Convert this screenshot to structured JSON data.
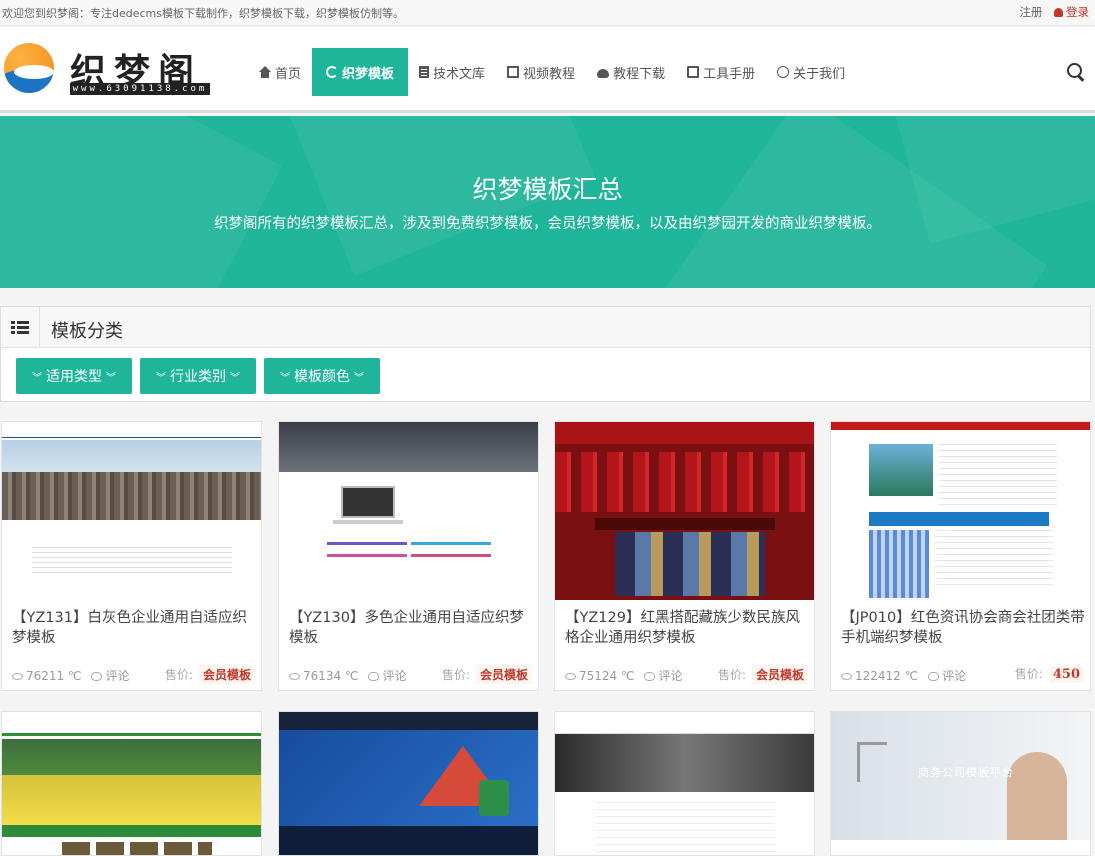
{
  "topbar": {
    "welcome": "欢迎您到织梦阁：专注dedecms模板下载制作，织梦模板下载，织梦模板仿制等。",
    "register": "注册",
    "login": "登录"
  },
  "logo": {
    "name": "织梦阁",
    "domain": "www.63091138.com"
  },
  "nav": [
    {
      "label": "首页",
      "icon": "home-icon"
    },
    {
      "label": "织梦模板",
      "icon": "refresh-icon",
      "active": true
    },
    {
      "label": "技术文库",
      "icon": "document-icon"
    },
    {
      "label": "视频教程",
      "icon": "film-icon"
    },
    {
      "label": "教程下载",
      "icon": "cloud-download-icon"
    },
    {
      "label": "工具手册",
      "icon": "book-icon"
    },
    {
      "label": "关于我们",
      "icon": "smile-icon"
    }
  ],
  "banner": {
    "title": "织梦模板汇总",
    "desc": "织梦阁所有的织梦模板汇总，涉及到免费织梦模板，会员织梦模板，以及由织梦园开发的商业织梦模板。"
  },
  "categories": {
    "title": "模板分类",
    "filters": [
      "适用类型",
      "行业类别",
      "模板颜色"
    ]
  },
  "cards": [
    {
      "title": "【YZ131】白灰色企业通用自适应织梦模板",
      "views": "76211 ℃",
      "comment": "评论",
      "price_label": "售价:",
      "price": "会员模板"
    },
    {
      "title": "【YZ130】多色企业通用自适应织梦模板",
      "views": "76134 ℃",
      "comment": "评论",
      "price_label": "售价:",
      "price": "会员模板"
    },
    {
      "title": "【YZ129】红黑搭配藏族少数民族风格企业通用织梦模板",
      "views": "75124 ℃",
      "comment": "评论",
      "price_label": "售价:",
      "price": "会员模板"
    },
    {
      "title": "【JP010】红色资讯协会商会社团类带手机端织梦模板",
      "views": "122412 ℃",
      "comment": "评论",
      "price_label": "售价:",
      "price": "450"
    }
  ],
  "thumb_text": {
    "t8_heading": "商务公司模板平台"
  },
  "colors": {
    "accent": "#1fb59b",
    "price_red": "#c0392b"
  }
}
